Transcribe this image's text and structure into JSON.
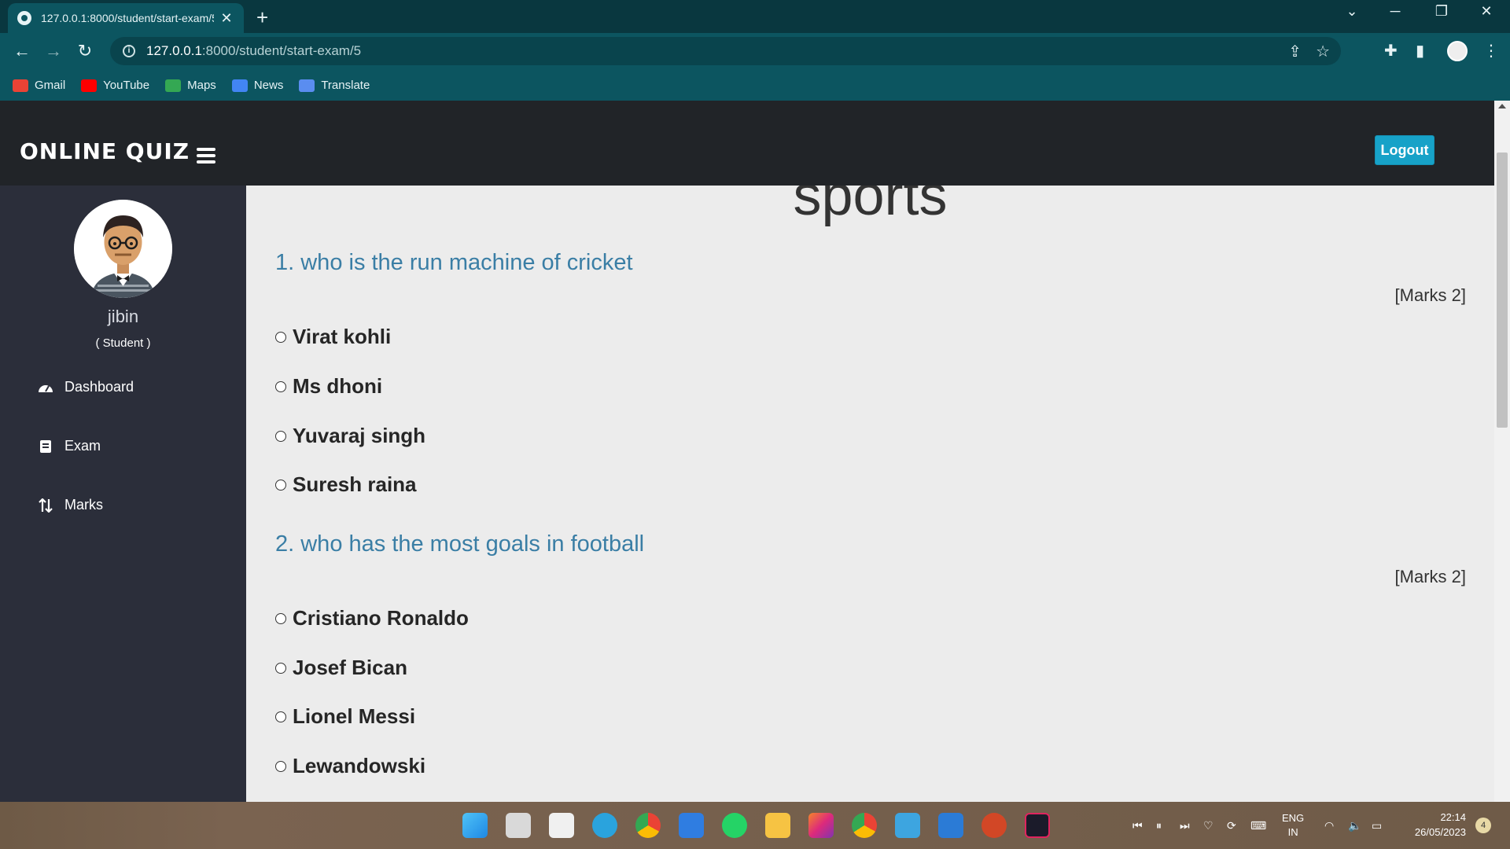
{
  "browser": {
    "tab_title": "127.0.0.1:8000/student/start-exam/5",
    "url_host": "127.0.0.1",
    "url_path": ":8000/student/start-exam/5",
    "bookmarks": [
      "Gmail",
      "YouTube",
      "Maps",
      "News",
      "Translate"
    ]
  },
  "header": {
    "brand": "ONLINE QUIZ",
    "logout_label": "Logout"
  },
  "sidebar": {
    "username": "jibin",
    "role": "( Student )",
    "items": [
      {
        "label": "Dashboard",
        "icon": "dashboard-icon"
      },
      {
        "label": "Exam",
        "icon": "book-icon"
      },
      {
        "label": "Marks",
        "icon": "sort-icon"
      }
    ]
  },
  "exam": {
    "title": "sports",
    "questions": [
      {
        "text": "1. who is the run machine of cricket",
        "marks": "[Marks 2]",
        "options": [
          "Virat kohli",
          "Ms dhoni",
          "Yuvaraj singh",
          "Suresh raina"
        ]
      },
      {
        "text": "2. who has the most goals in football",
        "marks": "[Marks 2]",
        "options": [
          "Cristiano Ronaldo",
          "Josef Bican",
          "Lionel Messi",
          "Lewandowski"
        ]
      }
    ]
  },
  "taskbar": {
    "language_line1": "ENG",
    "language_line2": "IN",
    "time": "22:14",
    "date": "26/05/2023",
    "notifications": "4"
  },
  "colors": {
    "header_bg": "#212428",
    "sidebar_bg": "#2b2e3a",
    "question_color": "#3a7ea5",
    "logout_bg": "#17a2c8",
    "browser_teal": "#0c5560"
  }
}
